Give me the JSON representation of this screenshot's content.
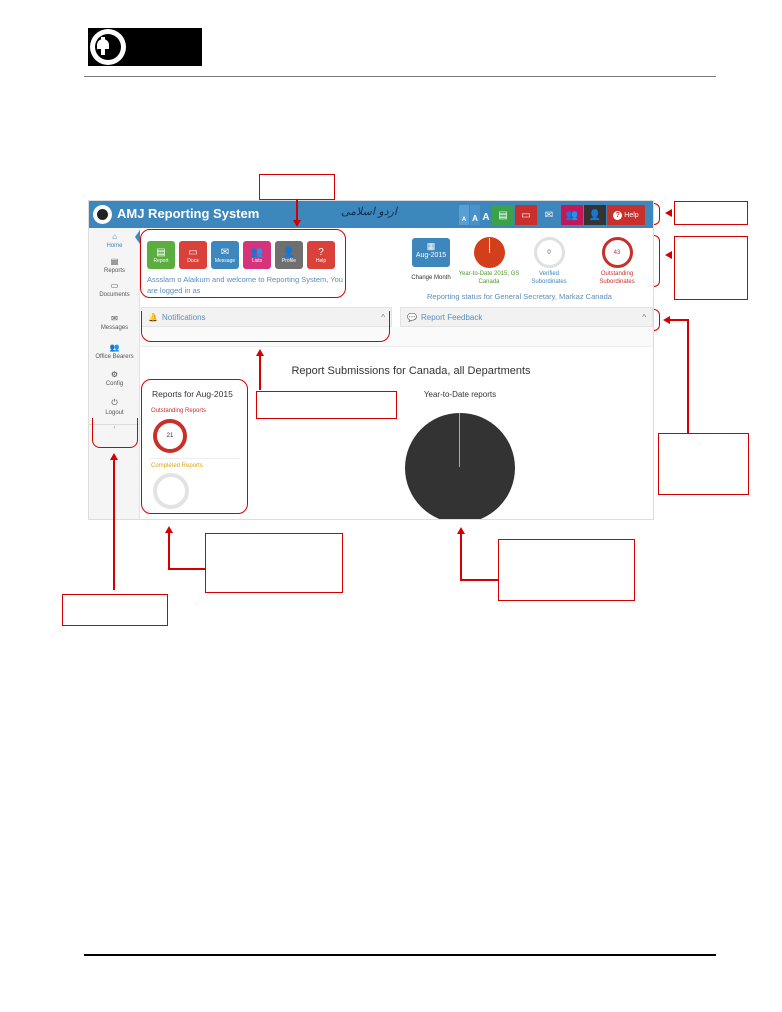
{
  "app": {
    "title": "AMJ Reporting System",
    "calligraphy": "اردو اسلامی"
  },
  "topbar": {
    "font_sizes": [
      "A",
      "A",
      "A"
    ],
    "buttons": [
      {
        "name": "report-icon",
        "icon": "▤",
        "color": "#3aa34a"
      },
      {
        "name": "docs-icon",
        "icon": "▭",
        "color": "#c9302c"
      },
      {
        "name": "message-icon",
        "icon": "✉",
        "color": "#3d87bd"
      },
      {
        "name": "lists-icon",
        "icon": "👥",
        "color": "#c2185b"
      },
      {
        "name": "profile-icon",
        "icon": "👤",
        "color": "#333333"
      }
    ],
    "help_label": "Help",
    "help_icon": "?"
  },
  "sidebar": {
    "items": [
      {
        "label": "Home",
        "icon": "⌂"
      },
      {
        "label": "Reports",
        "icon": "▤"
      },
      {
        "label": "Documents",
        "icon": "▭"
      },
      {
        "label": "Messages",
        "icon": "✉"
      },
      {
        "label": "Office Bearers",
        "icon": "👥"
      },
      {
        "label": "Config",
        "icon": "⚙"
      },
      {
        "label": "Logout",
        "icon": "⏻"
      }
    ],
    "collapse": "‹"
  },
  "tiles": [
    {
      "label": "Report",
      "icon": "▤",
      "color": "#5cad3f"
    },
    {
      "label": "Docs",
      "icon": "▭",
      "color": "#d9413a"
    },
    {
      "label": "Message",
      "icon": "✉",
      "color": "#3d87bd"
    },
    {
      "label": "Lists",
      "icon": "👥",
      "color": "#d6337a"
    },
    {
      "label": "Profile",
      "icon": "👤",
      "color": "#6f6f6f"
    },
    {
      "label": "Help",
      "icon": "?",
      "color": "#d9413a"
    }
  ],
  "welcome": "Assslam o Alaikum and welcome to Reporting System, You are logged in as",
  "month": {
    "icon": "▦",
    "label": "Aug-2015",
    "change_label": "Change Month"
  },
  "stats": {
    "ytd_label": "Year-to-Date 2015, GS Canada",
    "verified_value": "0",
    "verified_label": "Verified Subordinates",
    "outstanding_value": "43",
    "outstanding_label": "Outstanding Subordinates"
  },
  "reporting_status": "Reporting status for General Secretary, Markaz Canada",
  "panels": {
    "notifications": "Notifications",
    "feedback": "Report Feedback",
    "chevron": "^"
  },
  "submissions": {
    "title": "Report Submissions for Canada, all Departments",
    "reports_title": "Reports for Aug-2015",
    "outstanding_label": "Outstanding Reports",
    "outstanding_value": "21",
    "completed_label": "Completed Reports",
    "ytd_title": "Year-to-Date reports"
  }
}
